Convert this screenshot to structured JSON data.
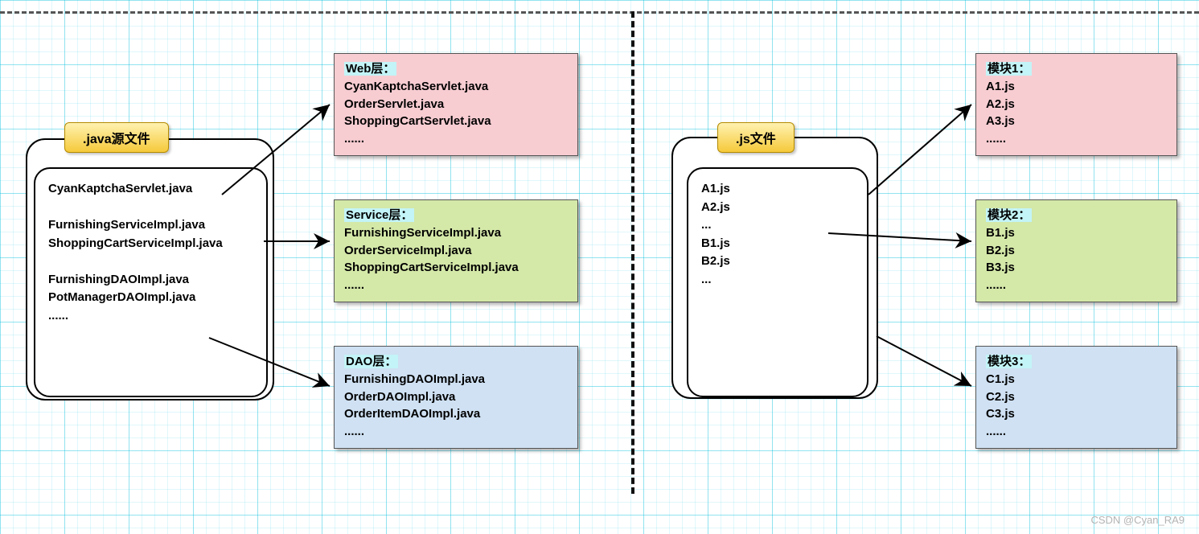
{
  "left": {
    "title": ".java源文件",
    "files": "CyanKaptchaServlet.java\n\nFurnishingServiceImpl.java\nShoppingCartServiceImpl.java\n\nFurnishingDAOImpl.java\nPotManagerDAOImpl.java\n......",
    "layers": {
      "web": {
        "title": "Web层：",
        "body": "CyanKaptchaServlet.java\nOrderServlet.java\nShoppingCartServlet.java\n......"
      },
      "service": {
        "title": "Service层：",
        "body": "FurnishingServiceImpl.java\nOrderServiceImpl.java\nShoppingCartServiceImpl.java\n......"
      },
      "dao": {
        "title": "DAO层：",
        "body": "FurnishingDAOImpl.java\nOrderDAOImpl.java\nOrderItemDAOImpl.java\n......"
      }
    }
  },
  "right": {
    "title": ".js文件",
    "files": "A1.js\nA2.js\n...\nB1.js\nB2.js\n...",
    "modules": {
      "m1": {
        "title": "模块1：",
        "body": "A1.js\nA2.js\nA3.js\n......"
      },
      "m2": {
        "title": "模块2：",
        "body": "B1.js\nB2.js\nB3.js\n......"
      },
      "m3": {
        "title": "模块3：",
        "body": "C1.js\nC2.js\nC3.js\n......"
      }
    }
  },
  "watermark": "CSDN @Cyan_RA9"
}
